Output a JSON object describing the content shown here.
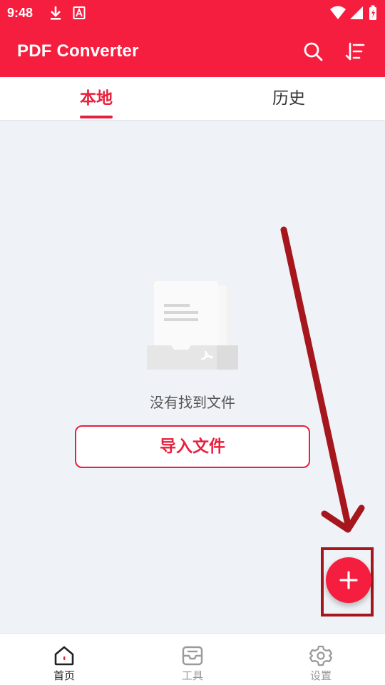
{
  "status_bar": {
    "time": "9:48",
    "icons": [
      "download-icon",
      "text-a-icon",
      "wifi-icon",
      "signal-icon",
      "battery-icon"
    ]
  },
  "app_bar": {
    "title": "PDF Converter",
    "actions": [
      "search-icon",
      "sort-icon"
    ]
  },
  "tabs": [
    {
      "label": "本地",
      "active": true
    },
    {
      "label": "历史",
      "active": false
    }
  ],
  "empty_state": {
    "message": "没有找到文件",
    "import_button_label": "导入文件",
    "illustration_icon": "empty-folder-pdf-icon"
  },
  "fab": {
    "icon": "plus-icon"
  },
  "bottom_nav": [
    {
      "label": "首页",
      "icon": "home-icon",
      "active": true
    },
    {
      "label": "工具",
      "icon": "toolbox-icon",
      "active": false
    },
    {
      "label": "设置",
      "icon": "gear-icon",
      "active": false
    }
  ],
  "colors": {
    "accent": "#f61e3f",
    "accent_text": "#e8203d",
    "background": "#eff2f6",
    "annotation": "#a5171d"
  }
}
